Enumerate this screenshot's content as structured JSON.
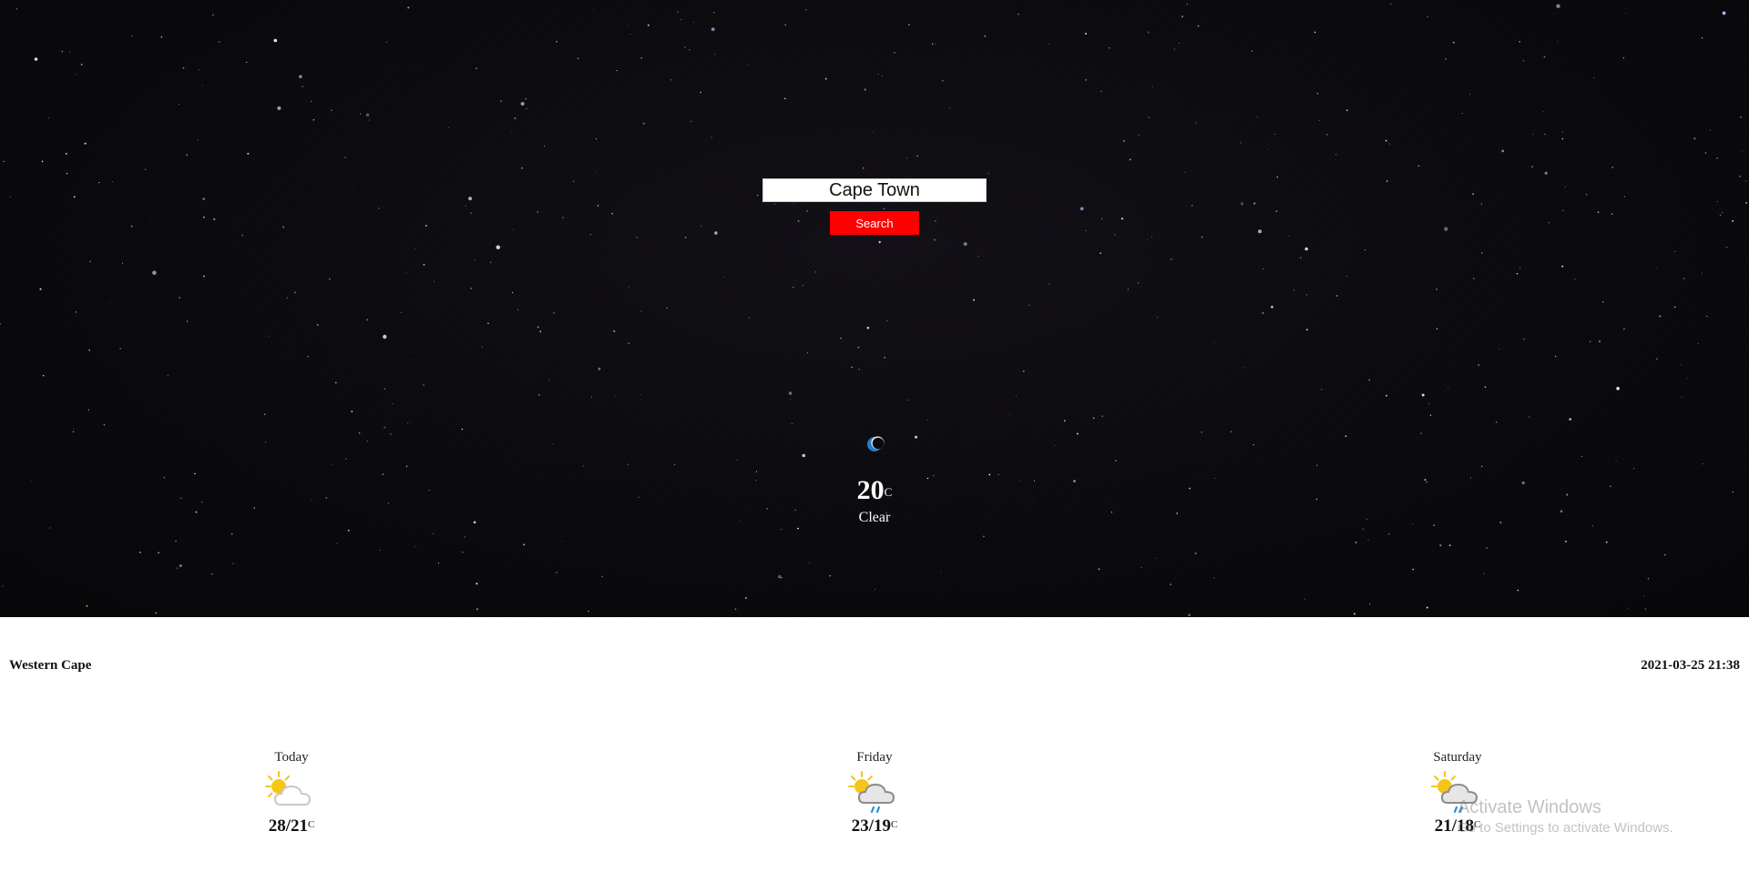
{
  "search": {
    "value": "Cape Town",
    "button_label": "Search"
  },
  "current": {
    "icon": "moon-icon",
    "temp": "20",
    "unit": "C",
    "description": "Clear"
  },
  "location": {
    "region": "Western Cape",
    "datetime": "2021-03-25 21:38"
  },
  "forecast": [
    {
      "day": "Today",
      "icon": "partly-cloudy-icon",
      "temp": "28/21",
      "unit": "C"
    },
    {
      "day": "Friday",
      "icon": "sun-cloud-rain-icon",
      "temp": "23/19",
      "unit": "C"
    },
    {
      "day": "Saturday",
      "icon": "sun-cloud-rain-icon",
      "temp": "21/18",
      "unit": "C"
    }
  ],
  "watermark": {
    "title": "Activate Windows",
    "subtitle": "Go to Settings to activate Windows."
  },
  "colors": {
    "sky": "#0a090c",
    "button": "#ff0000",
    "sun": "#f5c518",
    "moon": "#1e7fd6",
    "rain": "#2a8fd8"
  }
}
